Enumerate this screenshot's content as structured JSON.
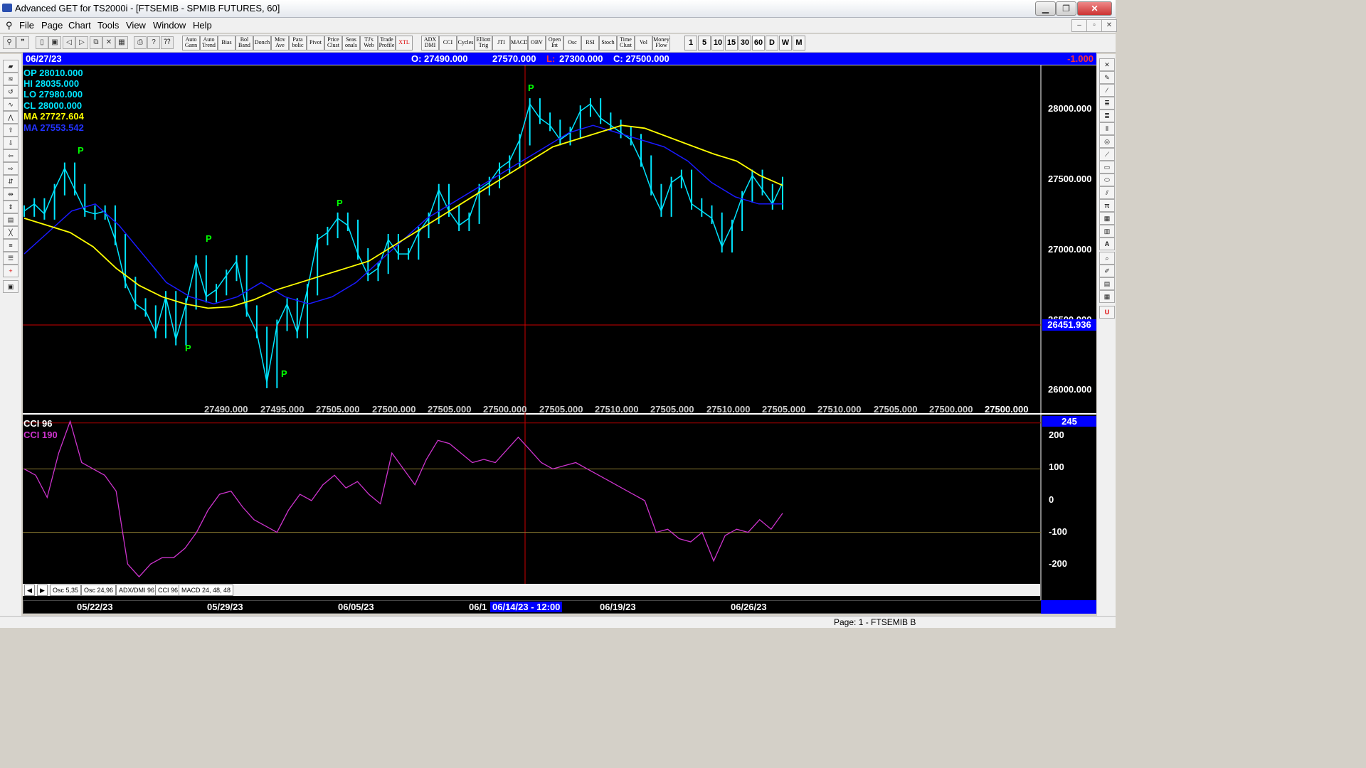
{
  "window": {
    "title": "Advanced GET for TS2000i - [FTSEMIB - SPMIB FUTURES, 60]",
    "min": "▁",
    "max": "❐",
    "close": "✕"
  },
  "menu": {
    "items": [
      "File",
      "Page",
      "Chart",
      "Tools",
      "View",
      "Window",
      "Help"
    ],
    "mdi": [
      "–",
      "▫",
      "✕"
    ]
  },
  "toolbar": {
    "studies": [
      [
        "Auto",
        "Gann"
      ],
      [
        "Auto",
        "Trend"
      ],
      [
        "Bias"
      ],
      [
        "Bol",
        "Band"
      ],
      [
        "Donch"
      ],
      [
        "Mov",
        "Ave"
      ],
      [
        "Para",
        "bolic"
      ],
      [
        "Pivot"
      ],
      [
        "Price",
        "Clust"
      ],
      [
        "Seas",
        "onals"
      ],
      [
        "TJ's",
        "Web"
      ],
      [
        "Trade",
        "Profile"
      ],
      [
        "XTL"
      ],
      [
        "ADX",
        "DMI"
      ],
      [
        "CCI"
      ],
      [
        "Cycles"
      ],
      [
        "Elliott",
        "Trig"
      ],
      [
        "JTI"
      ],
      [
        "MACD"
      ],
      [
        "OBV"
      ],
      [
        "Open",
        "Int"
      ],
      [
        "Osc"
      ],
      [
        "RSI"
      ],
      [
        "Stoch"
      ],
      [
        "Time",
        "Clust"
      ],
      [
        "Vol"
      ],
      [
        "Money",
        "Flow"
      ]
    ],
    "periods": [
      "1",
      "5",
      "10",
      "15",
      "30",
      "60",
      "D",
      "W",
      "M"
    ]
  },
  "infobar": {
    "date": "06/27/23",
    "open": "O: 27490.000",
    "high": "27570.000",
    "low_prefix": "L:",
    "low": "27300.000",
    "close": "C: 27500.000",
    "change": "-1.000"
  },
  "ohlc": {
    "op": "OP  28010.000",
    "hi": "HI   28035.000",
    "lo": "LO  27980.000",
    "cl": "CL  28000.000",
    "ma1": "MA  27727.604",
    "ma2": "MA  27553.542"
  },
  "price_axis": [
    "28000.000",
    "27500.000",
    "27000.000",
    "26500.000",
    "26000.000"
  ],
  "cursor_price": "26451.936",
  "bottom_values": [
    "27490.000",
    "27495.000",
    "27505.000",
    "27500.000",
    "27505.000",
    "27500.000",
    "27505.000",
    "27510.000",
    "27505.000",
    "27510.000",
    "27505.000",
    "27510.000",
    "27505.000",
    "27500.000",
    "27500.000"
  ],
  "cci": {
    "label1": "CCI 96",
    "label2": "CCI  190",
    "axis": [
      "200",
      "100",
      "0",
      "-100",
      "-200"
    ],
    "current": "245"
  },
  "pivot_marker": "P",
  "tabs": [
    "Osc 5,35",
    "Osc 24,96",
    "ADX/DMI 96",
    "CCI 96",
    "MACD 24, 48, 48"
  ],
  "dates": [
    "05/22/23",
    "05/29/23",
    "06/05/23",
    "06/1",
    "06/14/23 - 12:00",
    "06/19/23",
    "06/26/23"
  ],
  "status": "Page: 1 - FTSEMIB B",
  "colors": {
    "price": "#00e5ff",
    "ma_fast": "#ffff00",
    "ma_slow": "#1a1aff",
    "cci": "#cc33cc",
    "pivot": "#00ff00",
    "cursor": "#cc0000",
    "info_bg": "#0000ff"
  },
  "chart_data": {
    "type": "line",
    "x": [
      "05/22/23",
      "05/29/23",
      "06/05/23",
      "06/14/23",
      "06/19/23",
      "06/26/23"
    ],
    "price_ylim": [
      25900,
      28300
    ],
    "price": [
      27300,
      27350,
      27280,
      27450,
      27600,
      27450,
      27300,
      27280,
      27300,
      27100,
      26800,
      26650,
      26600,
      26450,
      26700,
      26400,
      26650,
      26950,
      26700,
      26750,
      26850,
      26950,
      26600,
      26450,
      26100,
      26500,
      26650,
      26450,
      26750,
      27100,
      27150,
      27250,
      27200,
      27000,
      26850,
      26900,
      27100,
      27000,
      27000,
      27150,
      27250,
      27450,
      27300,
      27200,
      27250,
      27450,
      27500,
      27600,
      27650,
      27800,
      28050,
      27950,
      27900,
      27800,
      27850,
      28000,
      28050,
      27950,
      27900,
      27850,
      27800,
      27650,
      27450,
      27300,
      27500,
      27550,
      27350,
      27300,
      27250,
      27050,
      27200,
      27400,
      27550,
      27450,
      27350,
      27500
    ],
    "ma_fast": [
      27250,
      27200,
      27150,
      27050,
      26900,
      26780,
      26700,
      26650,
      26620,
      26630,
      26680,
      26750,
      26800,
      26850,
      26900,
      26950,
      27050,
      27150,
      27250,
      27350,
      27450,
      27550,
      27650,
      27750,
      27800,
      27850,
      27900,
      27880,
      27820,
      27760,
      27700,
      27650,
      27550,
      27480
    ],
    "ma_slow": [
      27000,
      27150,
      27300,
      27350,
      27200,
      27000,
      26800,
      26700,
      26650,
      26700,
      26800,
      26700,
      26650,
      26700,
      26800,
      26950,
      27100,
      27250,
      27350,
      27450,
      27550,
      27650,
      27750,
      27850,
      27900,
      27850,
      27800,
      27750,
      27650,
      27500,
      27400,
      27350,
      27350
    ],
    "cci_ylim": [
      -260,
      260
    ],
    "cci": [
      100,
      80,
      10,
      150,
      250,
      120,
      100,
      80,
      30,
      -200,
      -240,
      -200,
      -180,
      -180,
      -150,
      -100,
      -30,
      20,
      30,
      -20,
      -60,
      -80,
      -100,
      -30,
      20,
      0,
      50,
      80,
      40,
      60,
      20,
      -10,
      150,
      100,
      50,
      130,
      190,
      180,
      150,
      120,
      130,
      120,
      160,
      200,
      160,
      120,
      100,
      110,
      120,
      100,
      80,
      60,
      40,
      20,
      0,
      -100,
      -90,
      -120,
      -130,
      -100,
      -190,
      -110,
      -90,
      -100,
      -60,
      -90,
      -40
    ]
  }
}
